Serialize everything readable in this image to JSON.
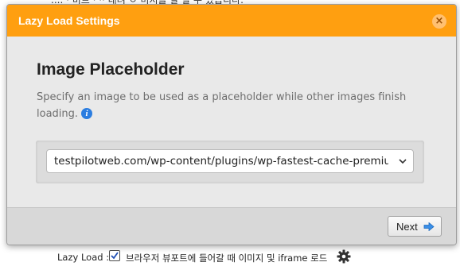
{
  "background": {
    "top_text": "....  ·  비트 ·  ·· 내려 ㅇ 미지를 알 할 수 있습니다.",
    "lazy_load_label": "Lazy Load :",
    "lazy_load_checked": true,
    "lazy_load_description": "브라우저 뷰포트에 들어갈 때 이미지 및 iframe 로드"
  },
  "modal": {
    "title": "Lazy Load Settings",
    "close_label": "×",
    "heading": "Image Placeholder",
    "description": "Specify an image to be used as a placeholder while other images finish loading.",
    "info_label": "i",
    "select": {
      "value": "testpilotweb.com/wp-content/plugins/wp-fastest-cache-premium/pro/images/blank.gif"
    },
    "next_label": "Next"
  },
  "colors": {
    "header": "#ff9f10",
    "info": "#2b7de0",
    "next_arrow": "#3a8ee6"
  },
  "icons": {
    "close": "close-icon",
    "info": "info-icon",
    "dropdown": "chevron-down-icon",
    "next": "arrow-right-icon",
    "settings": "gear-icon"
  }
}
